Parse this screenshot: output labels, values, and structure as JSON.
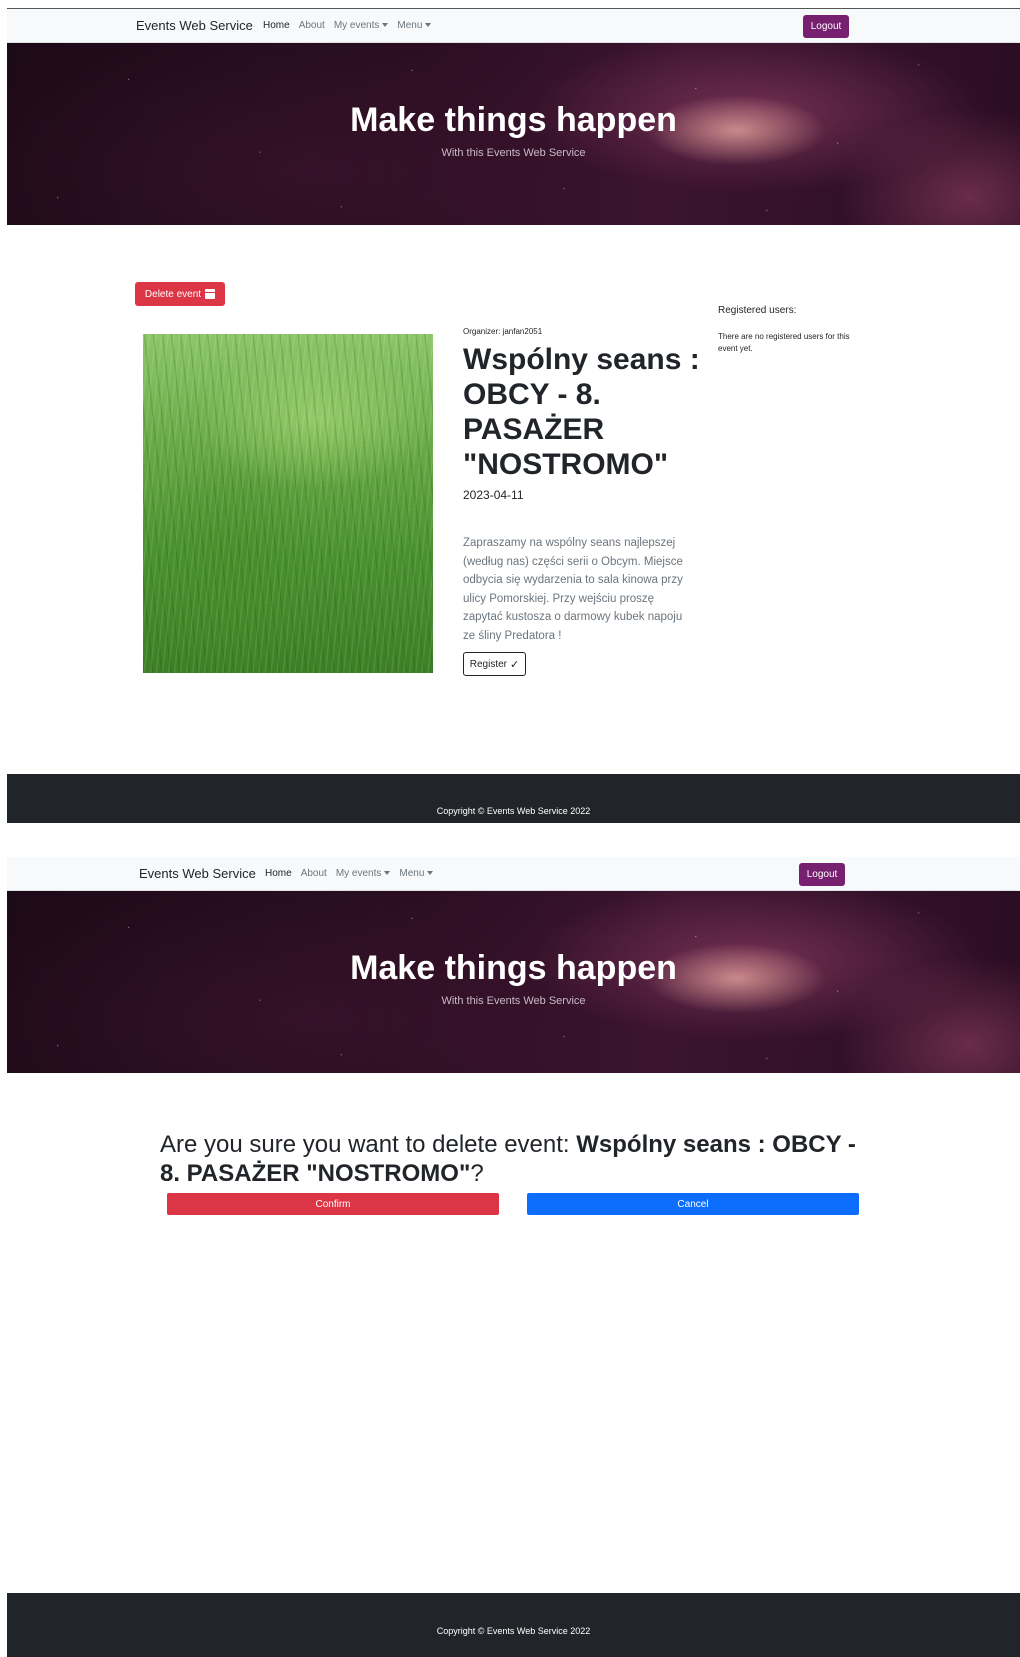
{
  "navbar": {
    "brand": "Events Web Service",
    "links": {
      "home": "Home",
      "about": "About",
      "my_events": "My events",
      "menu": "Menu"
    },
    "logout": "Logout"
  },
  "hero": {
    "title": "Make things happen",
    "subtitle": "With this Events Web Service"
  },
  "event_page": {
    "delete_button": "Delete event",
    "organizer": "Organizer: janfan2051",
    "title": "Wspólny seans : OBCY - 8. PASAŻER \"NOSTROMO\"",
    "date": "2023-04-11",
    "description": "Zapraszamy na wspólny seans najlepszej (według nas) części serii o Obcym. Miejsce odbycia się wydarzenia to sala kinowa przy ulicy Pomorskiej. Przy wejściu proszę zapytać kustosza o darmowy kubek napoju ze śliny Predatora !",
    "register_button": "Register",
    "registered_users_title": "Registered users:",
    "registered_users_empty": "There are no registered users for this event yet."
  },
  "confirm_page": {
    "question_prefix": "Are you sure you want to delete event: ",
    "event_name": "Wspólny seans : OBCY - 8. PASAŻER \"NOSTROMO\"",
    "question_suffix": "?",
    "confirm_button": "Confirm",
    "cancel_button": "Cancel"
  },
  "footer": {
    "copyright": "Copyright © Events Web Service 2022"
  },
  "colors": {
    "accent_purple": "#76206f",
    "danger": "#dc3545",
    "primary": "#0d6efd",
    "footer_bg": "#212529"
  }
}
